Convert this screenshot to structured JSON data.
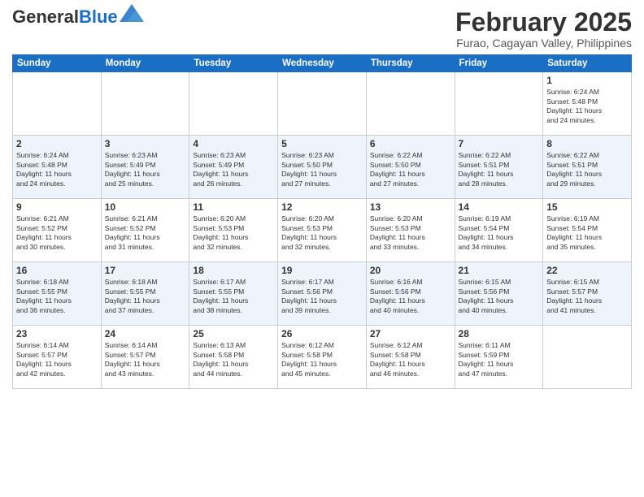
{
  "header": {
    "logo_general": "General",
    "logo_blue": "Blue",
    "title": "February 2025",
    "subtitle": "Furao, Cagayan Valley, Philippines"
  },
  "days_of_week": [
    "Sunday",
    "Monday",
    "Tuesday",
    "Wednesday",
    "Thursday",
    "Friday",
    "Saturday"
  ],
  "weeks": [
    [
      {
        "day": "",
        "info": ""
      },
      {
        "day": "",
        "info": ""
      },
      {
        "day": "",
        "info": ""
      },
      {
        "day": "",
        "info": ""
      },
      {
        "day": "",
        "info": ""
      },
      {
        "day": "",
        "info": ""
      },
      {
        "day": "1",
        "info": "Sunrise: 6:24 AM\nSunset: 5:48 PM\nDaylight: 11 hours\nand 24 minutes."
      }
    ],
    [
      {
        "day": "2",
        "info": "Sunrise: 6:24 AM\nSunset: 5:48 PM\nDaylight: 11 hours\nand 24 minutes."
      },
      {
        "day": "3",
        "info": "Sunrise: 6:23 AM\nSunset: 5:49 PM\nDaylight: 11 hours\nand 25 minutes."
      },
      {
        "day": "4",
        "info": "Sunrise: 6:23 AM\nSunset: 5:49 PM\nDaylight: 11 hours\nand 26 minutes."
      },
      {
        "day": "5",
        "info": "Sunrise: 6:23 AM\nSunset: 5:50 PM\nDaylight: 11 hours\nand 27 minutes."
      },
      {
        "day": "6",
        "info": "Sunrise: 6:22 AM\nSunset: 5:50 PM\nDaylight: 11 hours\nand 27 minutes."
      },
      {
        "day": "7",
        "info": "Sunrise: 6:22 AM\nSunset: 5:51 PM\nDaylight: 11 hours\nand 28 minutes."
      },
      {
        "day": "8",
        "info": "Sunrise: 6:22 AM\nSunset: 5:51 PM\nDaylight: 11 hours\nand 29 minutes."
      }
    ],
    [
      {
        "day": "9",
        "info": "Sunrise: 6:21 AM\nSunset: 5:52 PM\nDaylight: 11 hours\nand 30 minutes."
      },
      {
        "day": "10",
        "info": "Sunrise: 6:21 AM\nSunset: 5:52 PM\nDaylight: 11 hours\nand 31 minutes."
      },
      {
        "day": "11",
        "info": "Sunrise: 6:20 AM\nSunset: 5:53 PM\nDaylight: 11 hours\nand 32 minutes."
      },
      {
        "day": "12",
        "info": "Sunrise: 6:20 AM\nSunset: 5:53 PM\nDaylight: 11 hours\nand 32 minutes."
      },
      {
        "day": "13",
        "info": "Sunrise: 6:20 AM\nSunset: 5:53 PM\nDaylight: 11 hours\nand 33 minutes."
      },
      {
        "day": "14",
        "info": "Sunrise: 6:19 AM\nSunset: 5:54 PM\nDaylight: 11 hours\nand 34 minutes."
      },
      {
        "day": "15",
        "info": "Sunrise: 6:19 AM\nSunset: 5:54 PM\nDaylight: 11 hours\nand 35 minutes."
      }
    ],
    [
      {
        "day": "16",
        "info": "Sunrise: 6:18 AM\nSunset: 5:55 PM\nDaylight: 11 hours\nand 36 minutes."
      },
      {
        "day": "17",
        "info": "Sunrise: 6:18 AM\nSunset: 5:55 PM\nDaylight: 11 hours\nand 37 minutes."
      },
      {
        "day": "18",
        "info": "Sunrise: 6:17 AM\nSunset: 5:55 PM\nDaylight: 11 hours\nand 38 minutes."
      },
      {
        "day": "19",
        "info": "Sunrise: 6:17 AM\nSunset: 5:56 PM\nDaylight: 11 hours\nand 39 minutes."
      },
      {
        "day": "20",
        "info": "Sunrise: 6:16 AM\nSunset: 5:56 PM\nDaylight: 11 hours\nand 40 minutes."
      },
      {
        "day": "21",
        "info": "Sunrise: 6:15 AM\nSunset: 5:56 PM\nDaylight: 11 hours\nand 40 minutes."
      },
      {
        "day": "22",
        "info": "Sunrise: 6:15 AM\nSunset: 5:57 PM\nDaylight: 11 hours\nand 41 minutes."
      }
    ],
    [
      {
        "day": "23",
        "info": "Sunrise: 6:14 AM\nSunset: 5:57 PM\nDaylight: 11 hours\nand 42 minutes."
      },
      {
        "day": "24",
        "info": "Sunrise: 6:14 AM\nSunset: 5:57 PM\nDaylight: 11 hours\nand 43 minutes."
      },
      {
        "day": "25",
        "info": "Sunrise: 6:13 AM\nSunset: 5:58 PM\nDaylight: 11 hours\nand 44 minutes."
      },
      {
        "day": "26",
        "info": "Sunrise: 6:12 AM\nSunset: 5:58 PM\nDaylight: 11 hours\nand 45 minutes."
      },
      {
        "day": "27",
        "info": "Sunrise: 6:12 AM\nSunset: 5:58 PM\nDaylight: 11 hours\nand 46 minutes."
      },
      {
        "day": "28",
        "info": "Sunrise: 6:11 AM\nSunset: 5:59 PM\nDaylight: 11 hours\nand 47 minutes."
      },
      {
        "day": "",
        "info": ""
      }
    ]
  ]
}
